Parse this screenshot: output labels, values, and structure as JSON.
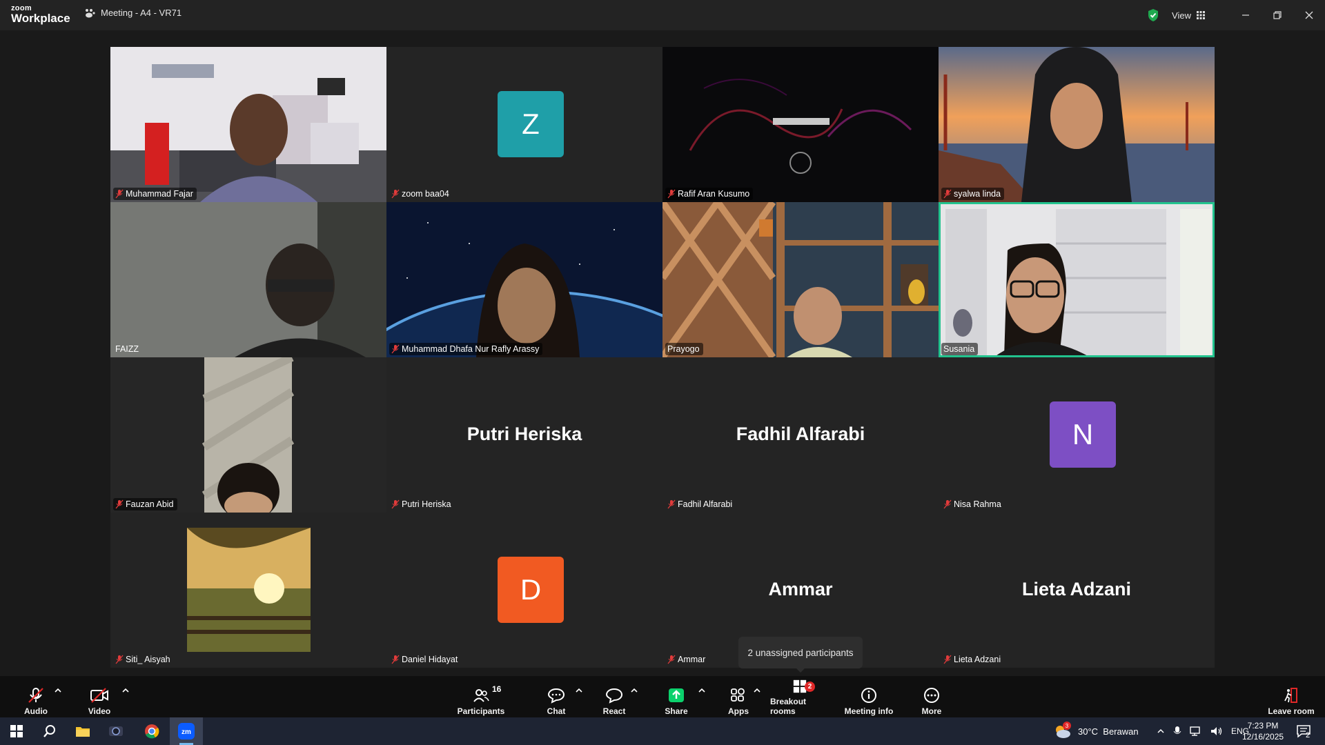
{
  "titlebar": {
    "logo_line1": "zoom",
    "logo_line2": "Workplace",
    "meeting_title": "Meeting - A4 - VR71",
    "view_label": "View"
  },
  "tiles": [
    {
      "id": "t1",
      "name": "Muhammad Fajar",
      "muted": true,
      "kind": "video"
    },
    {
      "id": "t2",
      "name": "zoom baa04",
      "muted": true,
      "kind": "avatar",
      "initial": "Z",
      "color": "#1f9fa8"
    },
    {
      "id": "t3",
      "name": "Rafif Aran Kusumo",
      "muted": true,
      "kind": "video"
    },
    {
      "id": "t4",
      "name": "syalwa linda",
      "muted": true,
      "kind": "video"
    },
    {
      "id": "t5",
      "name": "FAIZZ",
      "muted": false,
      "kind": "video"
    },
    {
      "id": "t6",
      "name": "Muhammad Dhafa Nur Rafly Arassy",
      "muted": true,
      "kind": "video"
    },
    {
      "id": "t7",
      "name": "Prayogo",
      "muted": false,
      "kind": "video"
    },
    {
      "id": "t8",
      "name": "Susania",
      "muted": false,
      "kind": "video",
      "active": true
    },
    {
      "id": "t9",
      "name": "Fauzan Abid",
      "muted": true,
      "kind": "video"
    },
    {
      "id": "t10",
      "name": "Putri Heriska",
      "muted": true,
      "kind": "name",
      "display": "Putri Heriska"
    },
    {
      "id": "t11",
      "name": "Fadhil Alfarabi",
      "muted": true,
      "kind": "name",
      "display": "Fadhil Alfarabi"
    },
    {
      "id": "t12",
      "name": "Nisa Rahma",
      "muted": true,
      "kind": "avatar",
      "initial": "N",
      "color": "#7d4fc4"
    },
    {
      "id": "t13",
      "name": "Siti_ Aisyah",
      "muted": true,
      "kind": "photo"
    },
    {
      "id": "t14",
      "name": "Daniel Hidayat",
      "muted": true,
      "kind": "avatar",
      "initial": "D",
      "color": "#f15a22"
    },
    {
      "id": "t15",
      "name": "Ammar",
      "muted": true,
      "kind": "name",
      "display": "Ammar"
    },
    {
      "id": "t16",
      "name": "Lieta Adzani",
      "muted": true,
      "kind": "name",
      "display": "Lieta Adzani"
    }
  ],
  "tooltip": "2 unassigned participants",
  "toolbar": {
    "audio": "Audio",
    "video": "Video",
    "participants": "Participants",
    "participants_count": "16",
    "chat": "Chat",
    "react": "React",
    "share": "Share",
    "apps": "Apps",
    "breakout": "Breakout rooms",
    "breakout_badge": "2",
    "meeting_info": "Meeting info",
    "more": "More",
    "leave": "Leave room"
  },
  "taskbar": {
    "weather_badge": "3",
    "weather": "30°C  Berawan",
    "lang": "ENG",
    "time": "7:23 PM",
    "date": "12/16/2025",
    "notif_count": "2"
  },
  "colors": {
    "share_green": "#0bd16c",
    "active_border": "#22c38e",
    "leave_red": "#e02828"
  }
}
